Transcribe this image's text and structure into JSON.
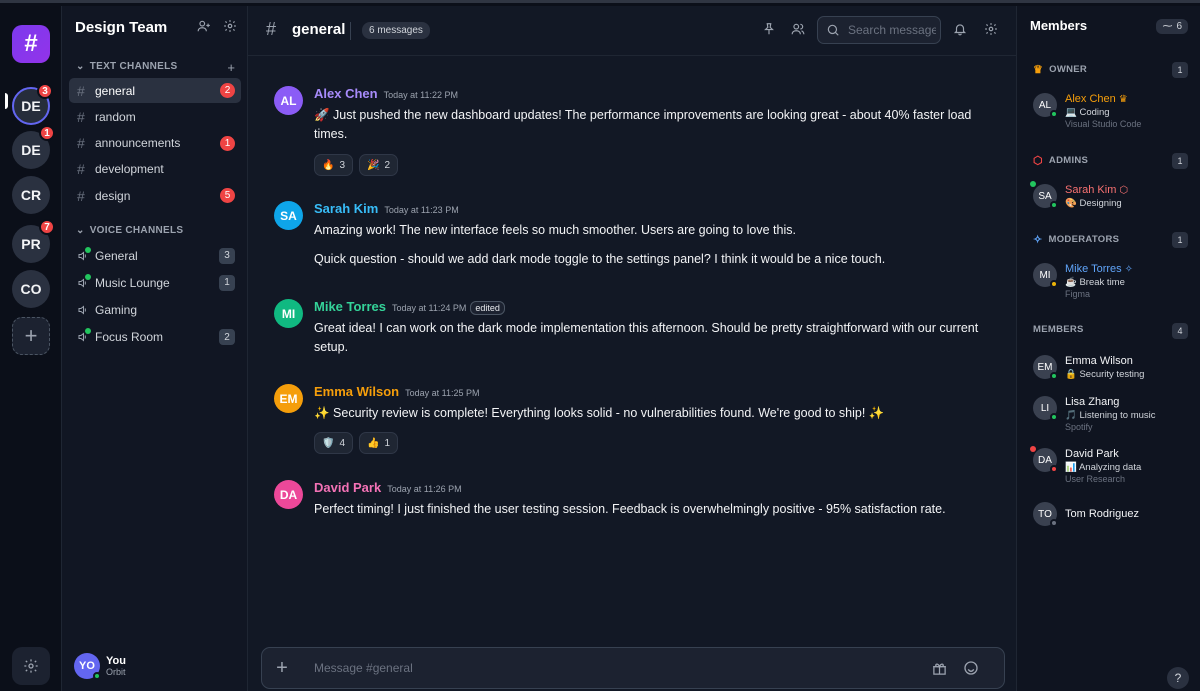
{
  "colors": {
    "accent": "#7c3aed",
    "danger": "#ef4444",
    "online": "#22c55e",
    "idle": "#eab308",
    "offline": "#6b7280"
  },
  "rail": {
    "logo_glyph": "#",
    "servers": [
      {
        "initials": "DE",
        "badge": "3"
      },
      {
        "initials": "DE",
        "badge": "1"
      },
      {
        "initials": "CR",
        "badge": ""
      },
      {
        "initials": "PR",
        "badge": "7"
      },
      {
        "initials": "CO",
        "badge": ""
      }
    ],
    "add_glyph": "+"
  },
  "sidebar": {
    "team_name": "Design Team",
    "text_header": "TEXT CHANNELS",
    "text_channels": [
      {
        "name": "general",
        "unread": "2"
      },
      {
        "name": "random",
        "unread": ""
      },
      {
        "name": "announcements",
        "unread": "1"
      },
      {
        "name": "development",
        "unread": ""
      },
      {
        "name": "design",
        "unread": "5"
      }
    ],
    "voice_header": "VOICE CHANNELS",
    "voice_channels": [
      {
        "name": "General",
        "count": "3"
      },
      {
        "name": "Music Lounge",
        "count": "1"
      },
      {
        "name": "Gaming",
        "count": ""
      },
      {
        "name": "Focus Room",
        "count": "2"
      }
    ],
    "user": {
      "initials": "YO",
      "name": "You",
      "server": "Orbit"
    }
  },
  "chat": {
    "channel": "general",
    "message_count": "6 messages",
    "search_placeholder": "Search messages...",
    "composer_placeholder": "Message #general",
    "messages": [
      {
        "initials": "AL",
        "author": "Alex Chen",
        "color": "#a78bfa",
        "avatar": "#8b5cf6",
        "time": "Today at 11:22 PM",
        "edited": "",
        "lines": [
          "🚀 Just pushed the new dashboard updates! The performance improvements are looking great - about 40% faster load times."
        ],
        "reactions": [
          {
            "emoji": "🔥",
            "count": "3"
          },
          {
            "emoji": "🎉",
            "count": "2"
          }
        ]
      },
      {
        "initials": "SA",
        "author": "Sarah Kim",
        "color": "#38bdf8",
        "avatar": "#0ea5e9",
        "time": "Today at 11:23 PM",
        "edited": "",
        "lines": [
          "Amazing work! The new interface feels so much smoother. Users are going to love this.",
          "Quick question - should we add dark mode toggle to the settings panel? I think it would be a nice touch."
        ],
        "reactions": []
      },
      {
        "initials": "MI",
        "author": "Mike Torres",
        "color": "#34d399",
        "avatar": "#10b981",
        "time": "Today at 11:24 PM",
        "edited": "edited",
        "lines": [
          "Great idea! I can work on the dark mode implementation this afternoon. Should be pretty straightforward with our current setup."
        ],
        "reactions": []
      },
      {
        "initials": "EM",
        "author": "Emma Wilson",
        "color": "#f59e0b",
        "avatar": "#f59e0b",
        "time": "Today at 11:25 PM",
        "edited": "",
        "lines": [
          "✨ Security review is complete! Everything looks solid - no vulnerabilities found. We're good to ship! ✨"
        ],
        "reactions": [
          {
            "emoji": "🛡️",
            "count": "4"
          },
          {
            "emoji": "👍",
            "count": "1"
          }
        ]
      },
      {
        "initials": "DA",
        "author": "David Park",
        "color": "#f472b6",
        "avatar": "#ec4899",
        "time": "Today at 11:26 PM",
        "edited": "",
        "lines": [
          "Perfect timing! I just finished the user testing session. Feedback is overwhelmingly positive - 95% satisfaction rate."
        ],
        "reactions": []
      }
    ]
  },
  "members": {
    "title": "Members",
    "count": "6",
    "groups": [
      {
        "label": "OWNER",
        "icon": "crown",
        "count": "1",
        "items": [
          {
            "initials": "AL",
            "name": "Alex Chen",
            "suffix": "♛",
            "name_color": "#f59e0b",
            "activity": "💻 Coding",
            "app": "Visual Studio Code",
            "status": "online"
          }
        ]
      },
      {
        "label": "ADMINS",
        "icon": "shield",
        "count": "1",
        "items": [
          {
            "initials": "SA",
            "name": "Sarah Kim",
            "suffix": "⬡",
            "name_color": "#f87171",
            "activity": "🎨 Designing",
            "app": "",
            "status": "online"
          }
        ]
      },
      {
        "label": "MODERATORS",
        "icon": "star",
        "count": "1",
        "items": [
          {
            "initials": "MI",
            "name": "Mike Torres",
            "suffix": "✧",
            "name_color": "#60a5fa",
            "activity": "☕ Break time",
            "app": "Figma",
            "status": "idle"
          }
        ]
      },
      {
        "label": "MEMBERS",
        "icon": "",
        "count": "4",
        "items": [
          {
            "initials": "EM",
            "name": "Emma Wilson",
            "suffix": "",
            "name_color": "#f3f4f6",
            "activity": "🔒 Security testing",
            "app": "",
            "status": "online"
          },
          {
            "initials": "LI",
            "name": "Lisa Zhang",
            "suffix": "",
            "name_color": "#f3f4f6",
            "activity": "🎵 Listening to music",
            "app": "Spotify",
            "status": "online"
          },
          {
            "initials": "DA",
            "name": "David Park",
            "suffix": "",
            "name_color": "#f3f4f6",
            "activity": "📊 Analyzing data",
            "app": "User Research",
            "status": "dnd"
          },
          {
            "initials": "TO",
            "name": "Tom Rodriguez",
            "suffix": "",
            "name_color": "#f3f4f6",
            "activity": "",
            "app": "",
            "status": "offline"
          }
        ]
      }
    ]
  },
  "help_glyph": "?"
}
